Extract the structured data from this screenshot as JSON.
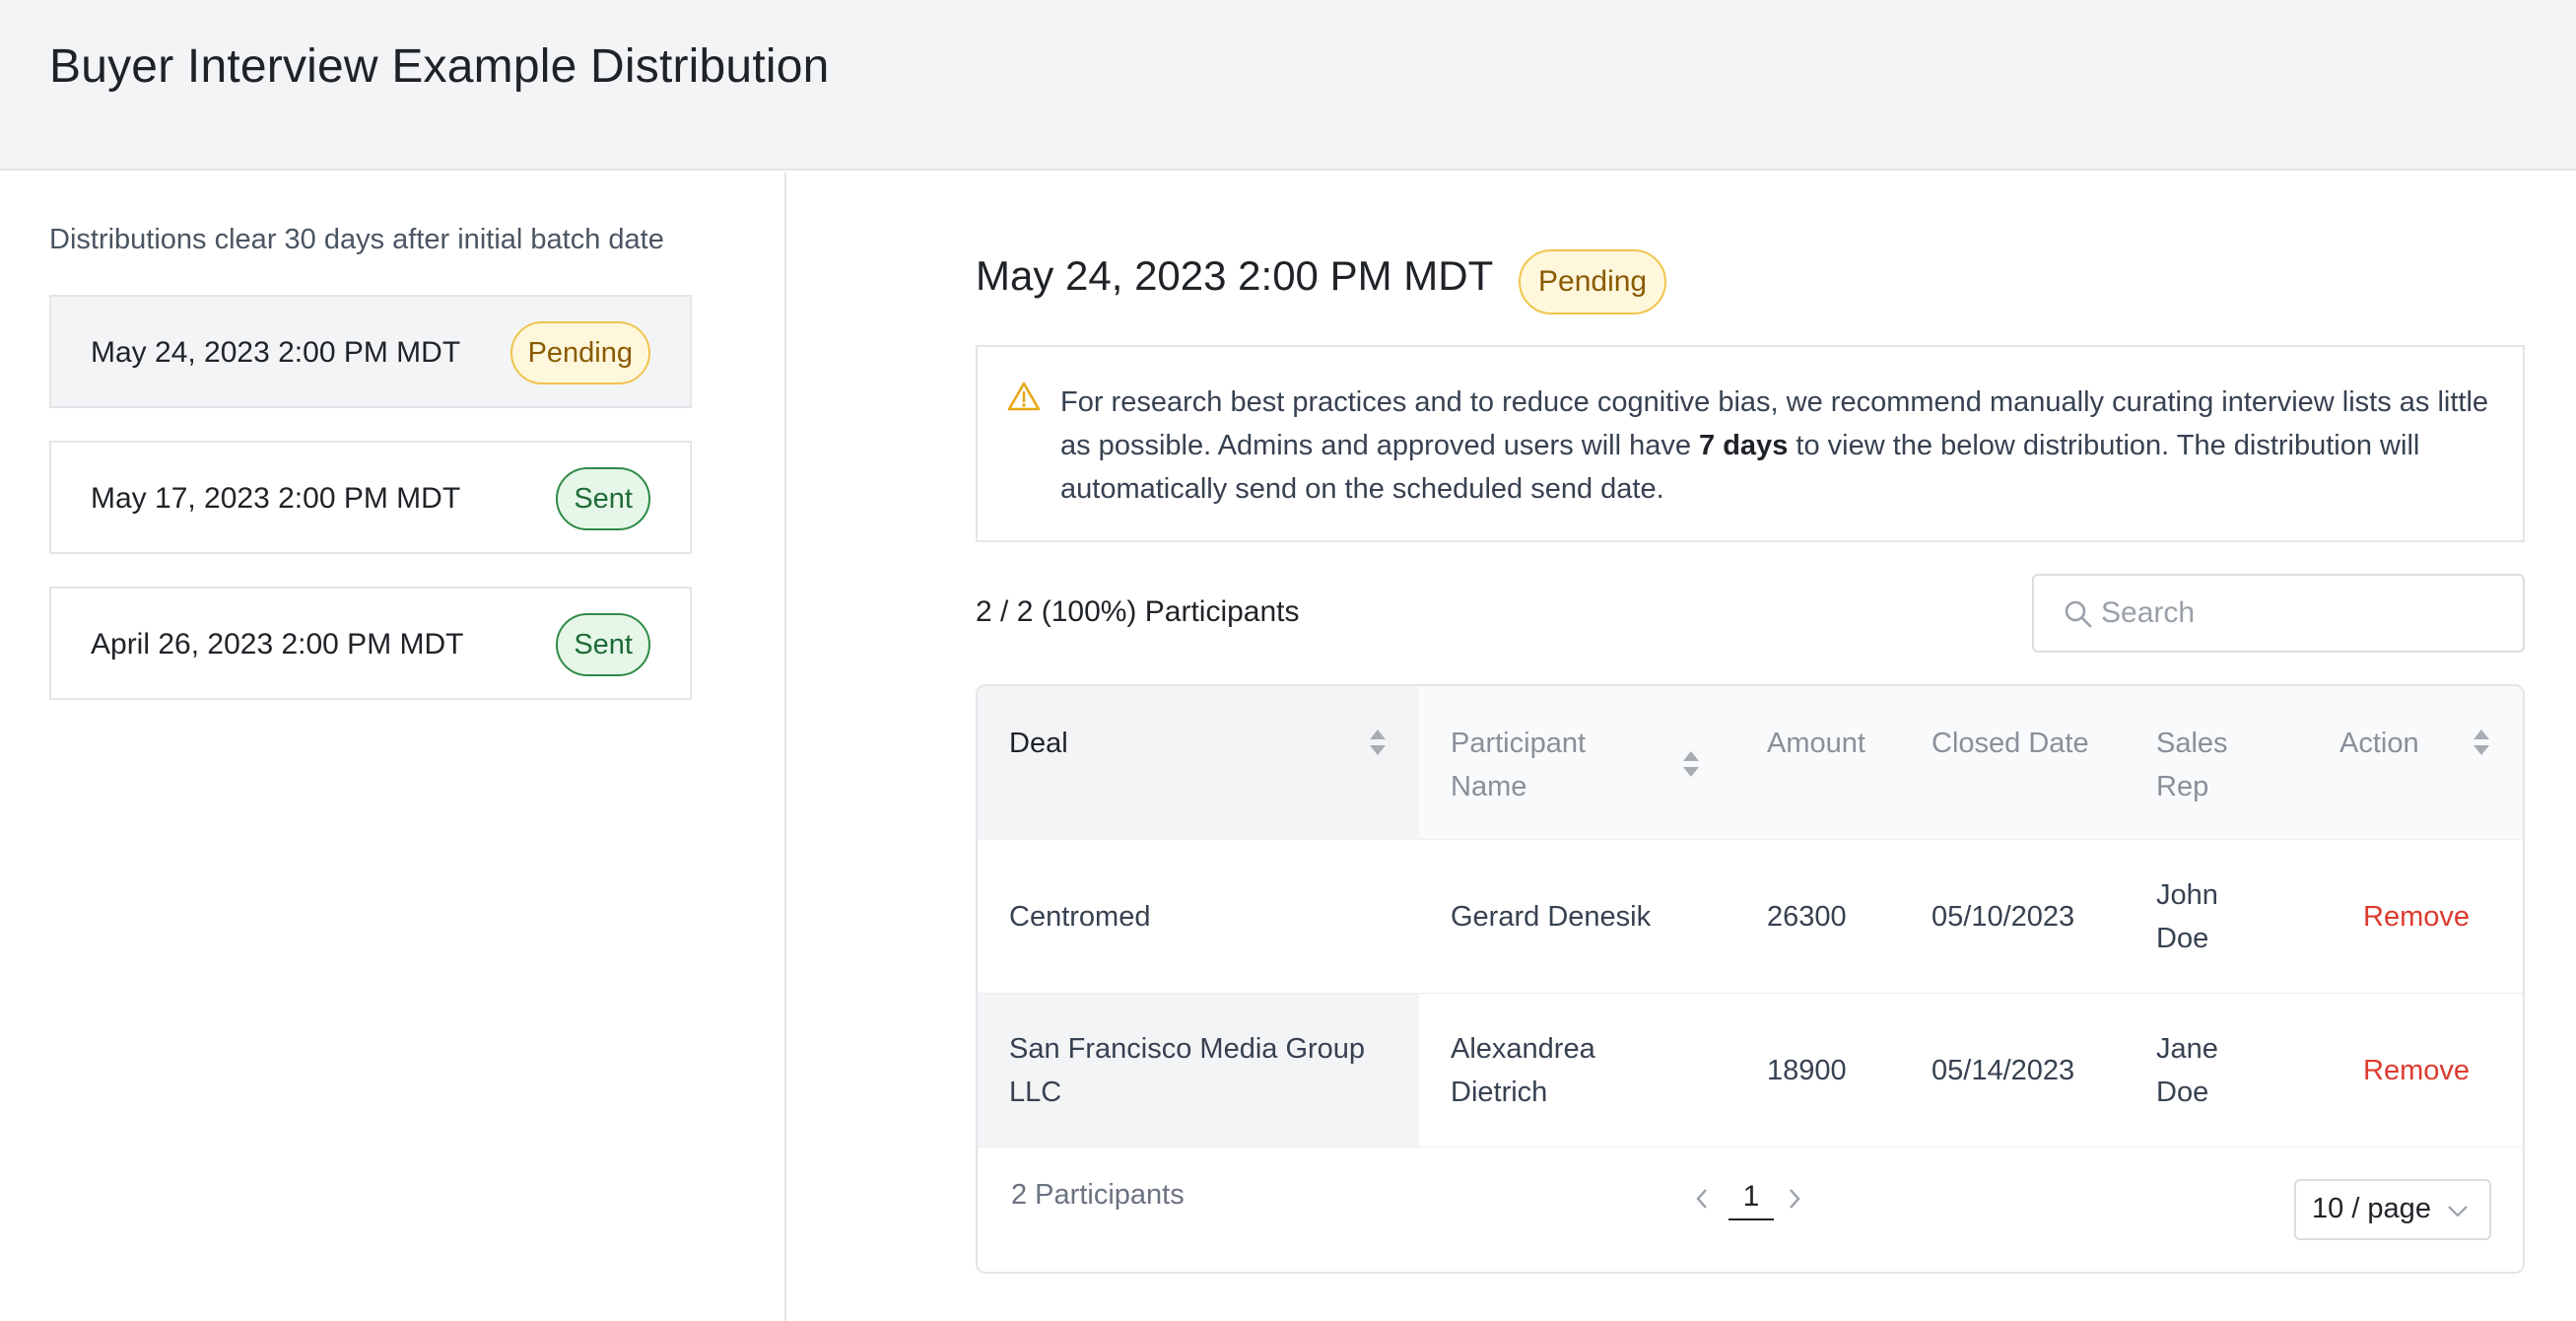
{
  "header": {
    "title": "Buyer Interview Example Distribution"
  },
  "sidebar": {
    "note": "Distributions clear 30 days after initial batch date",
    "batches": [
      {
        "date": "May 24, 2023 2:00 PM MDT",
        "status": "Pending",
        "selected": true
      },
      {
        "date": "May 17, 2023 2:00 PM MDT",
        "status": "Sent",
        "selected": false
      },
      {
        "date": "April 26, 2023 2:00 PM MDT",
        "status": "Sent",
        "selected": false
      }
    ]
  },
  "main": {
    "title": "May 24, 2023 2:00 PM MDT",
    "status": "Pending",
    "alert": {
      "icon": "warning-icon",
      "text_before": "For research best practices and to reduce cognitive bias, we recommend manually curating interview lists as little as possible. Admins and approved users will have ",
      "text_bold": "7 days",
      "text_after": " to view the below distribution. The distribution will automatically send on the scheduled send date."
    },
    "participant_count": "2 / 2 (100%) Participants",
    "search": {
      "placeholder": "Search",
      "value": ""
    },
    "table": {
      "columns": [
        {
          "label": "Deal",
          "sortable": true
        },
        {
          "label": "Participant Name",
          "sortable": true
        },
        {
          "label": "Amount",
          "sortable": false
        },
        {
          "label": "Closed Date",
          "sortable": false
        },
        {
          "label": "Sales Rep",
          "sortable": false
        },
        {
          "label": "Action",
          "sortable": true
        }
      ],
      "rows": [
        {
          "deal": "Centromed",
          "participant": "Gerard Denesik",
          "amount": "26300",
          "closed_date": "05/10/2023",
          "sales_rep": "John Doe",
          "action": "Remove"
        },
        {
          "deal": "San Francisco Media Group LLC",
          "participant": "Alexandrea Dietrich",
          "amount": "18900",
          "closed_date": "05/14/2023",
          "sales_rep": "Jane Doe",
          "action": "Remove"
        }
      ],
      "footer": {
        "total": "2 Participants",
        "current_page": "1",
        "page_size": "10 / page"
      }
    },
    "colors": {
      "pending_bg": "#fef7dc",
      "pending_border": "#f0c44d",
      "sent_bg": "#e6f7ea",
      "sent_border": "#2f8a47",
      "remove": "#dc3b2f",
      "warning": "#e6a817"
    }
  }
}
